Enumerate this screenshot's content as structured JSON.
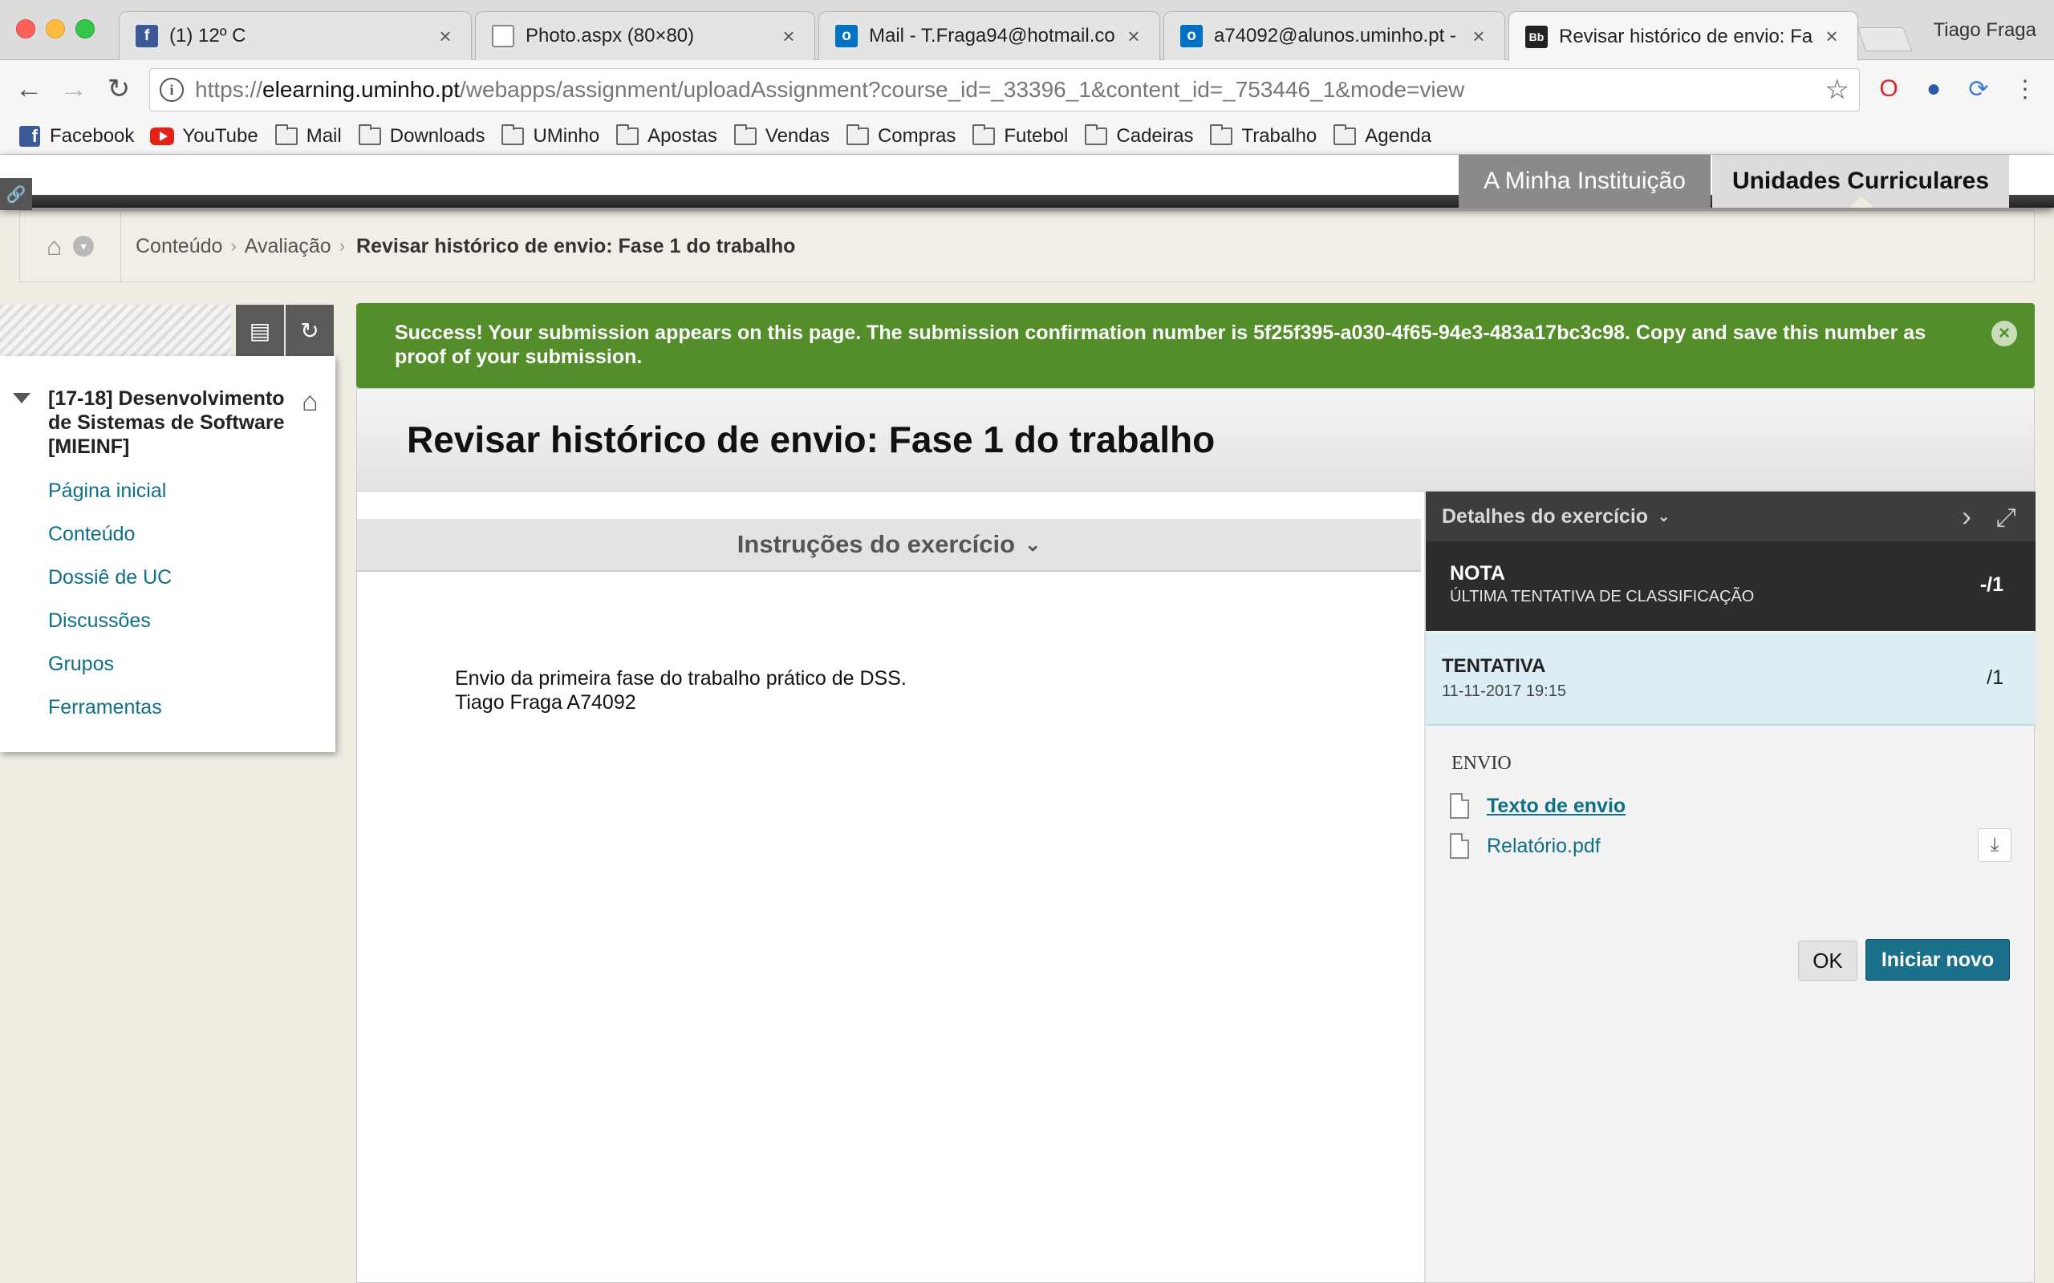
{
  "browser": {
    "tabs": [
      {
        "title": "(1) 12º C",
        "icon": "facebook-icon"
      },
      {
        "title": "Photo.aspx (80×80)",
        "icon": "page-icon"
      },
      {
        "title": "Mail - T.Fraga94@hotmail.co",
        "icon": "outlook-icon"
      },
      {
        "title": "a74092@alunos.uminho.pt -",
        "icon": "outlook-icon"
      },
      {
        "title": "Revisar histórico de envio: Fa",
        "icon": "blackboard-icon"
      }
    ],
    "profile_name": "Tiago Fraga",
    "url_scheme": "https://",
    "url_host": "elearning.uminho.pt",
    "url_path": "/webapps/assignment/uploadAssignment?course_id=_33396_1&content_id=_753446_1&mode=view",
    "bookmarks": [
      "Facebook",
      "YouTube",
      "Mail",
      "Downloads",
      "UMinho",
      "Apostas",
      "Vendas",
      "Compras",
      "Futebol",
      "Cadeiras",
      "Trabalho",
      "Agenda"
    ]
  },
  "header": {
    "institution_tab": "A Minha Instituição",
    "courses_tab": "Unidades Curriculares"
  },
  "breadcrumb": {
    "items": [
      "Conteúdo",
      "Avaliação"
    ],
    "current": "Revisar histórico de envio: Fase 1 do trabalho"
  },
  "course_menu": {
    "title": "[17-18] Desenvolvimento de Sistemas de Software [MIEINF]",
    "links": [
      "Página inicial",
      "Conteúdo",
      "Dossiê de UC",
      "Discussões",
      "Grupos",
      "Ferramentas"
    ]
  },
  "success_message": "Success! Your submission appears on this page. The submission confirmation number is 5f25f395-a030-4f65-94e3-483a17bc3c98. Copy and save this number as proof of your submission.",
  "page": {
    "title": "Revisar histórico de envio: Fase 1 do trabalho",
    "instructions_header": "Instruções do exercício",
    "instructions_line1": "Envio da primeira fase do trabalho prático de DSS.",
    "instructions_line2": "Tiago Fraga A74092"
  },
  "details_panel": {
    "header": "Detalhes do exercício",
    "grade_label": "NOTA",
    "grade_sub": "ÚLTIMA TENTATIVA DE CLASSIFICAÇÃO",
    "grade_value": "-/1",
    "attempt_label": "TENTATIVA",
    "attempt_date": "11-11-2017 19:15",
    "attempt_value": "/1",
    "submission_label": "ENVIO",
    "files": [
      "Texto de envio",
      "Relatório.pdf"
    ],
    "ok_button": "OK",
    "new_button": "Iniciar novo"
  },
  "colors": {
    "success_green": "#548e2b",
    "link_teal": "#0e6f86",
    "primary_button": "#1a6f8b"
  }
}
